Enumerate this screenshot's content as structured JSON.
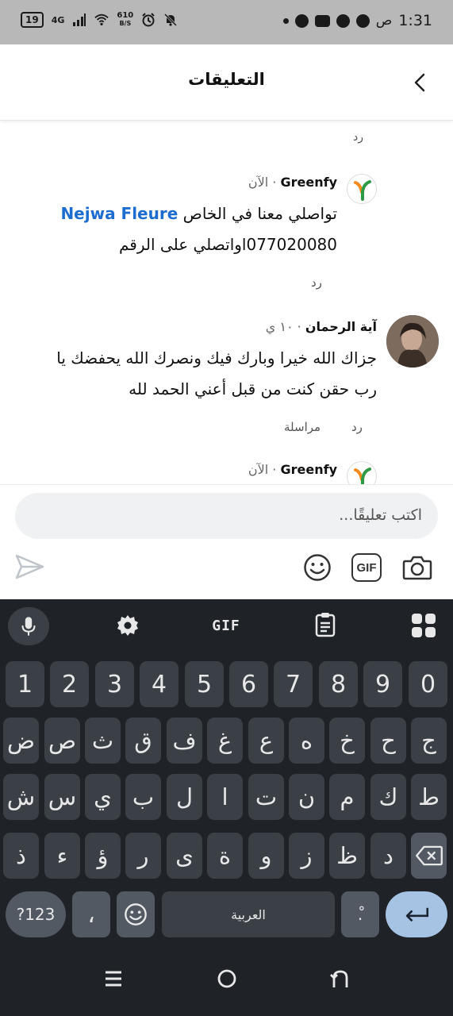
{
  "status_bar": {
    "time": "1:31",
    "time_suffix": "ص",
    "battery": "19",
    "network": "4G",
    "speed_value": "610",
    "speed_unit": "B/S"
  },
  "header": {
    "title": "التعليقات"
  },
  "top_reply_label": "رد",
  "comments": [
    {
      "author": "Greenfy",
      "time": "الآن",
      "mention": "Nejwa Fleure",
      "text_line1": "تواصلي معنا في الخاص",
      "text_line2": "077020080اواتصلي على الرقم",
      "reply": "رد"
    },
    {
      "author": "آية الرحمان",
      "time": "١٠ ي",
      "text_line1": "جزاك الله خيرا وبارك فيك ونصرك الله يحفضك يا",
      "text_line2": "رب حقن كنت من قبل أعني الحمد لله",
      "reply": "رد",
      "message": "مراسلة"
    },
    {
      "author": "Greenfy",
      "time": "الآن"
    }
  ],
  "input": {
    "placeholder": "اكتب تعليقًا...",
    "gif_label": "GIF"
  },
  "keyboard": {
    "toolbar_gif": "GIF",
    "numbers": [
      "1",
      "2",
      "3",
      "4",
      "5",
      "6",
      "7",
      "8",
      "9",
      "0"
    ],
    "row1": [
      "ض",
      "ص",
      "ث",
      "ق",
      "ف",
      "غ",
      "ع",
      "ه",
      "خ",
      "ح",
      "ج"
    ],
    "row2": [
      "ش",
      "س",
      "ي",
      "ب",
      "ل",
      "ا",
      "ت",
      "ن",
      "م",
      "ك",
      "ط"
    ],
    "row3": [
      "ذ",
      "ء",
      "ؤ",
      "ر",
      "ى",
      "ة",
      "و",
      "ز",
      "ظ",
      "د"
    ],
    "symbols_key": "?123",
    "comma_key": "،",
    "space_label": "العربية",
    "punct_key": ".ْ"
  },
  "colors": {
    "status_bg": "#b8b8b8",
    "mention": "#1c6dcf",
    "keyboard_bg": "#1f2327",
    "key_bg": "#3b4046",
    "enter_bg": "#a7c3e4"
  }
}
